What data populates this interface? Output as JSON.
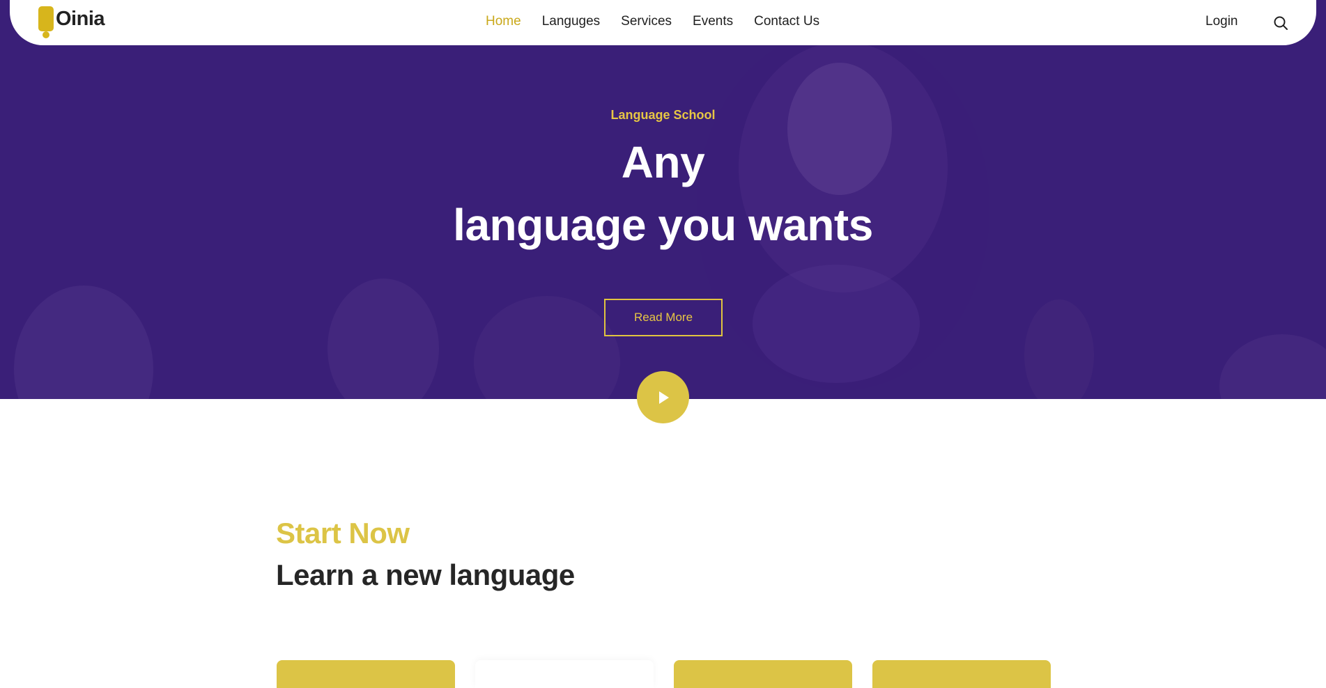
{
  "brand": {
    "name": "Oinia",
    "accent_color": "#d7b51c",
    "hero_bg_color": "#3a1f78"
  },
  "nav": {
    "links": [
      {
        "label": "Home",
        "active": true
      },
      {
        "label": "Languges",
        "active": false
      },
      {
        "label": "Services",
        "active": false
      },
      {
        "label": "Events",
        "active": false
      },
      {
        "label": "Contact Us",
        "active": false
      }
    ],
    "login_label": "Login",
    "search_icon": "search-icon"
  },
  "hero": {
    "eyebrow": "Language School",
    "title_line1": "Any",
    "title_line2": "language you wants",
    "button_label": "Read More",
    "play_icon": "play-icon"
  },
  "section": {
    "eyebrow": "Start Now",
    "title": "Learn a new language"
  }
}
